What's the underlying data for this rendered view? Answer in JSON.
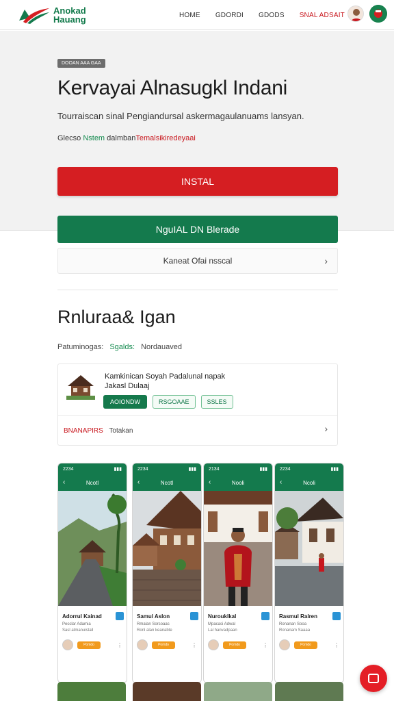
{
  "header": {
    "brand_line1": "Anokad",
    "brand_line2": "Hauang",
    "nav": [
      "HOME",
      "GDORDI",
      "GDODS"
    ],
    "nav_accent": "SNAL ADSAIT",
    "colors": {
      "brand_green": "#147a4d",
      "brand_red": "#d51e22"
    }
  },
  "hero": {
    "tag": "DOOAN AAA GAA",
    "title": "Kervayai Alnasugkl Indani",
    "subtitle": "Tourraiscan sinal Pengiandursal askermagaulanuams lansyan.",
    "meta_prefix": "Glecso",
    "meta_green": "Nstem",
    "meta_mid": "dalmban",
    "meta_red": "Temalsikiredeyaai",
    "install_label": "INSTAL",
    "green_button_label": "NguIAL DN Blerade",
    "link_row_label": "Kaneat Ofai nsscal",
    "chevron_icon": "chevron-right-icon"
  },
  "section": {
    "title": "Rnluraa& Igan",
    "meta_prefix": "Patuminogas:",
    "meta_green": "Sgalds:",
    "meta_suffix": "Nordauaved"
  },
  "card": {
    "line1": "Kamkinican Soyah Padalunal napak",
    "line2": "Jakasl Dulaaj",
    "chips": [
      "AOIONDW",
      "RSGOAAE",
      "SSLES"
    ],
    "foot_red": "BNANAPIRS",
    "foot_text": "Totakan"
  },
  "phones": [
    {
      "time": "2234",
      "title": "Ncotl",
      "name": "Adorrul Kainad",
      "loc": "Pecclar Adamia",
      "meta": "Sasl atmanuistall",
      "tag": "Pomdo",
      "scene": "road"
    },
    {
      "time": "2234",
      "title": "Ncotl",
      "name": "Samul Aslon",
      "loc": "Rmalan Sorsoaas",
      "meta": "Ronl alan keanabte",
      "tag": "Pomdo",
      "scene": "house"
    },
    {
      "time": "2134",
      "title": "Nooli",
      "name": "Nurouklkal",
      "loc": "Mpacasi Adwal",
      "meta": "Lal hanvadpaan",
      "tag": "Pomdo",
      "scene": "person"
    },
    {
      "time": "2234",
      "title": "Ncoli",
      "name": "Rasmul Ralren",
      "loc": "Ronanan Sooa",
      "meta": "Ronanam Saaaa",
      "tag": "Pomdo",
      "scene": "rain"
    }
  ],
  "fab": {
    "icon": "chat-icon"
  }
}
